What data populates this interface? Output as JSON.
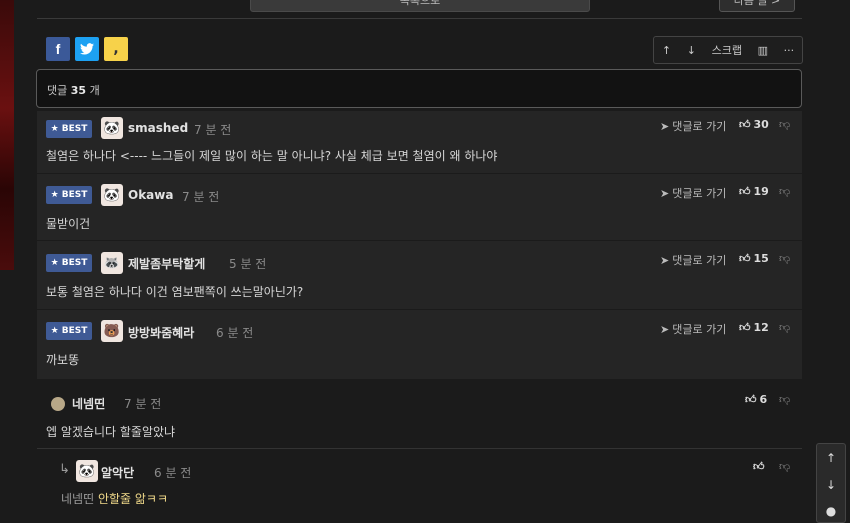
{
  "nav": {
    "list_label": "목록으로",
    "next_label": "다음 글 >"
  },
  "share": {
    "facebook": "f",
    "twitter": "t",
    "kakao": ","
  },
  "toolbar": {
    "up": "↑",
    "down": "↓",
    "scrap": "스크랩",
    "stats": "▥",
    "more": "···"
  },
  "comment_count": {
    "label": "댓글",
    "count": "35",
    "unit": "개"
  },
  "best_comments": [
    {
      "badge": "★ BEST",
      "nick": "smashed",
      "time": "7 분 전",
      "reply": "댓글로 가기",
      "likes": "30",
      "text": "철염은 하나다 <---- 느그들이 제일 많이 하는 말 아니냐? 사실 체급 보면 철염이 왜 하나야"
    },
    {
      "badge": "★ BEST",
      "nick": "Okawa",
      "time": "7 분 전",
      "reply": "댓글로 가기",
      "likes": "19",
      "text": "물받이건"
    },
    {
      "badge": "★ BEST",
      "nick": "제발좀부탁할게",
      "time": "5 분 전",
      "reply": "댓글로 가기",
      "likes": "15",
      "text": "보통 철염은 하나다 이건 염보팬쪽이 쓰는말아닌가?"
    },
    {
      "badge": "★ BEST",
      "nick": "방방봐줌혜라",
      "time": "6 분 전",
      "reply": "댓글로 가기",
      "likes": "12",
      "text": "까보똥"
    }
  ],
  "comments": [
    {
      "nick": "네넴띤",
      "time": "7 분 전",
      "likes": "6",
      "text": "엡 알겠습니다 할줄알았냐"
    }
  ],
  "replies": [
    {
      "nick": "알악단",
      "time": "6 분 전",
      "mention": "네넴띤",
      "text": "안할줄 앎ㅋㅋ"
    }
  ],
  "sidebar": {
    "up": "↑",
    "down": "↓",
    "comment": "●"
  },
  "colors": {
    "background": "#1b1b1b",
    "best_badge": "#3f5a95",
    "highlight": "#f0d98a"
  }
}
